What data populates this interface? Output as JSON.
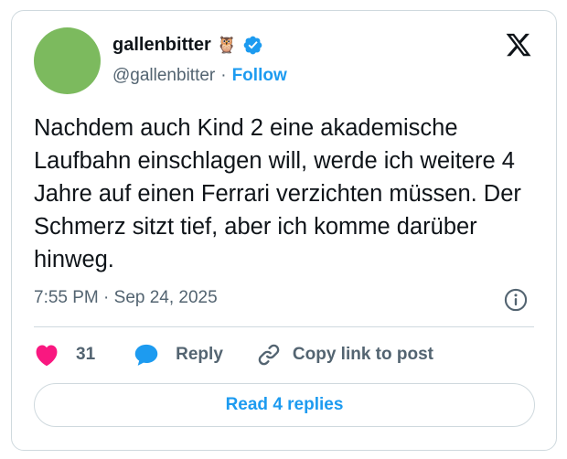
{
  "colors": {
    "accent": "#1d9bf0",
    "like": "#f91880",
    "secondary_text": "#536471",
    "avatar": "#7cba5e"
  },
  "author": {
    "display_name": "gallenbitter",
    "name_glyph": "🦉",
    "verified_icon": "verified-badge-icon",
    "handle": "@gallenbitter",
    "separator": "·",
    "follow_label": "Follow"
  },
  "brand_icon": "x-logo-icon",
  "tweet": {
    "text": "Nachdem auch Kind 2 eine akademische Laufbahn einschlagen will, werde ich weitere 4 Jahre auf einen Ferrari verzichten müssen. Der Schmerz sitzt tief, aber ich komme darüber hinweg.",
    "timestamp": "7:55 PM · Sep 24, 2025"
  },
  "actions": {
    "like_icon": "heart-icon",
    "like_count": "31",
    "reply_icon": "speech-bubble-icon",
    "reply_label": "Reply",
    "copy_icon": "link-icon",
    "copy_label": "Copy link to post"
  },
  "info_icon": "info-icon",
  "read_replies_label": "Read 4 replies"
}
